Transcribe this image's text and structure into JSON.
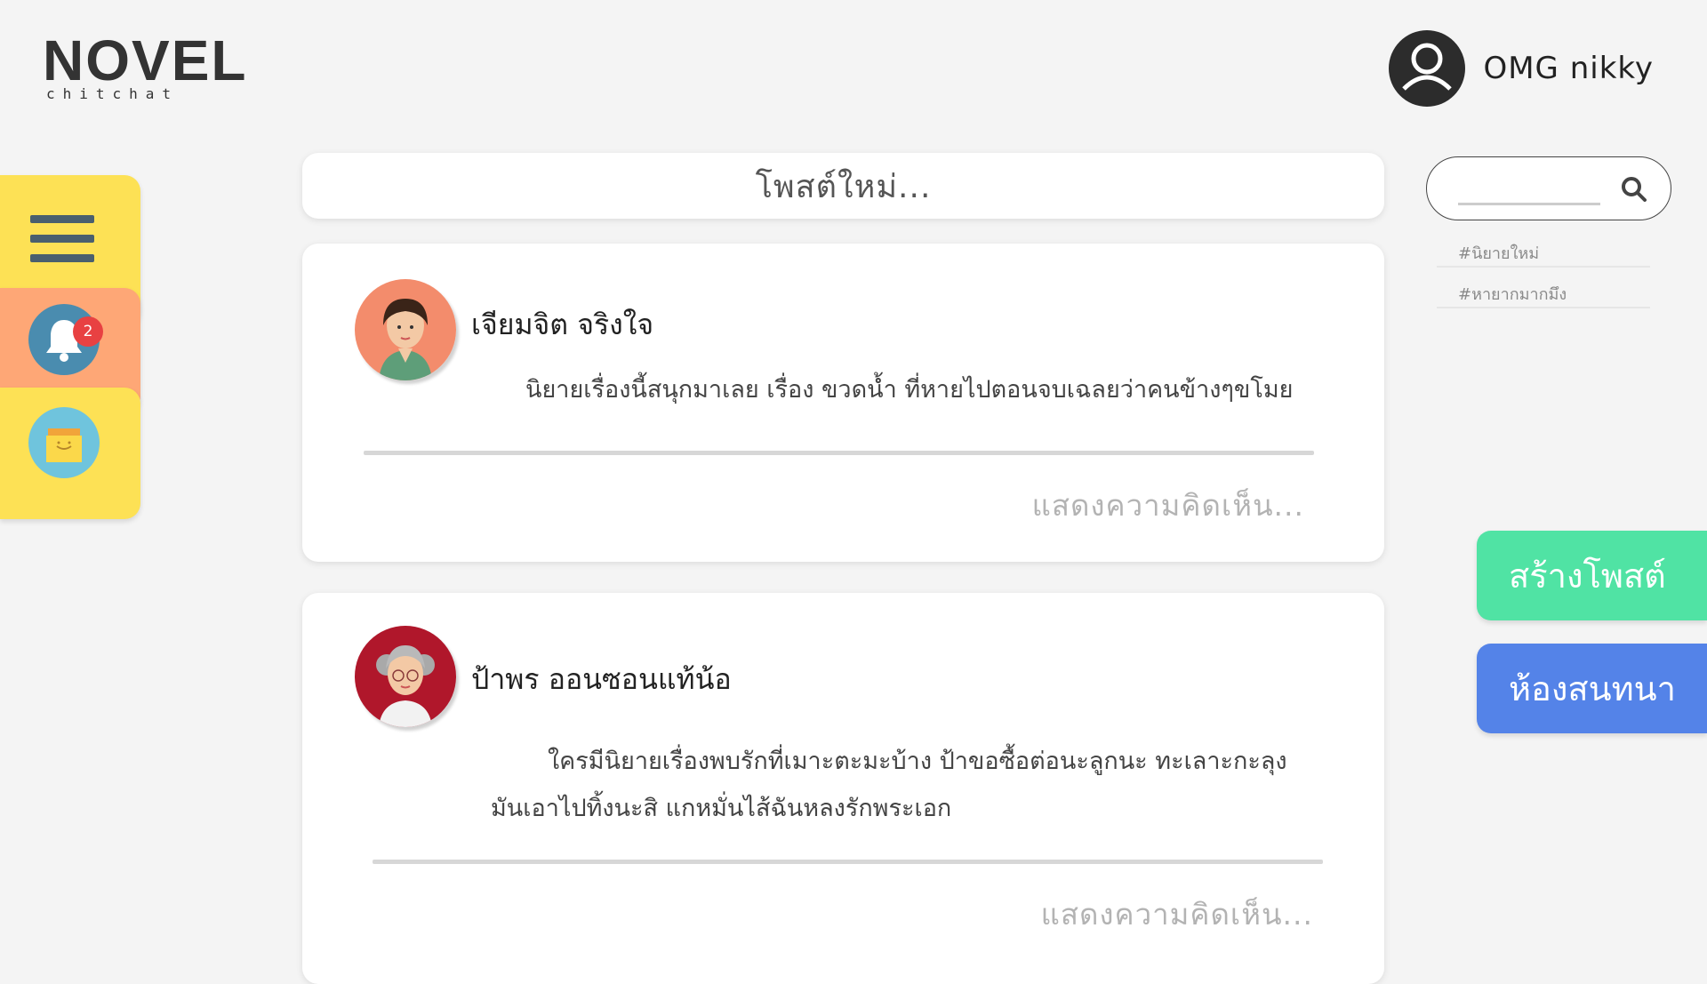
{
  "brand": {
    "logo_main": "NOVEL",
    "logo_sub": "chitchat"
  },
  "user": {
    "name": "OMG nikky",
    "icon": "user-circle-icon"
  },
  "nav": {
    "menu_icon": "hamburger-icon",
    "notification_icon": "bell-icon",
    "notification_count": "2",
    "shop_icon": "shopping-bag-icon"
  },
  "feed": {
    "new_post_placeholder": "โพสต์ใหม่...",
    "posts": [
      {
        "author": "เจียมจิต จริงใจ",
        "lines": [
          "นิยายเรื่องนี้สนุกมาเลย เรื่อง ขวดน้ำ ที่หายไปตอนจบเฉลยว่าคนข้างๆขโมย"
        ],
        "comment_placeholder": "แสดงความคิดเห็น..."
      },
      {
        "author": "ป้าพร ออนซอนแท้น้อ",
        "lines": [
          "ใครมีนิยายเรื่องพบรักที่เมาะตะมะบ้าง ป้าขอซื้อต่อนะลูกนะ ทะเลาะกะลุง",
          "มันเอาไปทิ้งนะสิ แกหมั่นไส้ฉันหลงรักพระเอก"
        ],
        "comment_placeholder": "แสดงความคิดเห็น..."
      }
    ]
  },
  "sidebar": {
    "search_icon": "search-icon",
    "tags": [
      "#นิยายใหม่",
      "#หายากมากมึง"
    ]
  },
  "actions": {
    "create_post": "สร้างโพสต์",
    "chat_room": "ห้องสนทนา"
  },
  "colors": {
    "background": "#f4f4f4",
    "nav_yellow": "#fde155",
    "nav_orange": "#fea776",
    "create_green": "#50e3a4",
    "chat_blue": "#5483e8",
    "badge_red": "#e84142"
  }
}
